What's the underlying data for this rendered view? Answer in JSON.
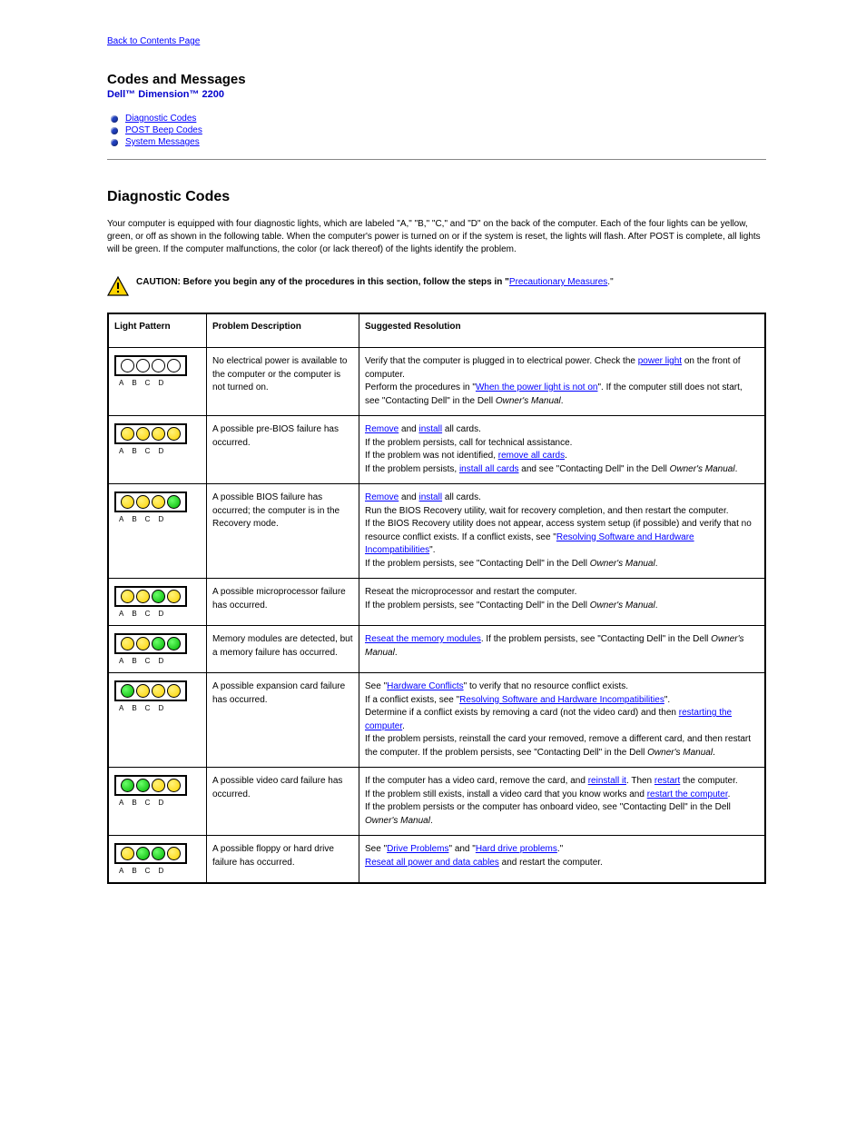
{
  "back": "Back to Contents Page",
  "page_title": "Codes and Messages",
  "subtitle": "Dell™ Dimension™ 2200",
  "toc": [
    {
      "label": "Diagnostic Codes"
    },
    {
      "label": "POST Beep Codes"
    },
    {
      "label": "System Messages"
    }
  ],
  "section_title": "Diagnostic Codes",
  "section_desc_1": "Your computer is equipped with four diagnostic lights, which are labeled \"A,\" \"B,\" \"C,\" and \"D\" on the back of the computer. Each of the four lights can be yellow, green, or off as shown in the following table. When the computer's power is turned on or if the system is reset, the lights will flash. After POST is complete, all lights will be green. If the computer malfunctions, the color (or lack thereof) of the lights identify the problem.",
  "caution_bold": "CAUTION: Before you begin any of the procedures in this section, follow the steps in \"",
  "caution_link": "Precautionary Measures",
  "caution_tail": ".\"",
  "table": {
    "headers": [
      "Light Pattern",
      "Problem Description",
      "Suggested Resolution"
    ],
    "label_row": "A   B   C   D",
    "rows": [
      {
        "lights": [
          "off",
          "off",
          "off",
          "off"
        ],
        "problem": "No electrical power is available to the computer or the computer is not turned on.",
        "resolution_segments": [
          {
            "t": "Verify that the computer is plugged in to electrical power. Check the ",
            "link": false
          },
          {
            "t": "power light",
            "link": true
          },
          {
            "t": " on the front of computer.",
            "link": false
          },
          {
            "t": "\nPerform the procedures in \"",
            "link": false
          },
          {
            "t": "When the power light is not on",
            "link": true
          },
          {
            "t": "\". If the computer still does not start, see \"Contacting Dell\" in the Dell ",
            "link": false
          },
          {
            "t": "Owner's Manual",
            "link": false,
            "italic": true
          },
          {
            "t": ".",
            "link": false
          }
        ]
      },
      {
        "lights": [
          "y",
          "y",
          "y",
          "y"
        ],
        "problem": "A possible pre-BIOS failure has occurred.",
        "resolution_segments": [
          {
            "t": "Remove",
            "link": true
          },
          {
            "t": " and ",
            "link": false
          },
          {
            "t": "install",
            "link": true
          },
          {
            "t": " all cards.",
            "link": false
          },
          {
            "t": "\nIf the problem persists, call for technical assistance.",
            "link": false
          },
          {
            "t": "\nIf the problem was not identified, ",
            "link": false
          },
          {
            "t": "remove all cards",
            "link": true
          },
          {
            "t": ".",
            "link": false
          },
          {
            "t": "\nIf the problem persists, ",
            "link": false
          },
          {
            "t": "install all cards",
            "link": true
          },
          {
            "t": " and see \"Contacting Dell\" in the Dell ",
            "link": false
          },
          {
            "t": "Owner's Manual",
            "link": false,
            "italic": true
          },
          {
            "t": ".",
            "link": false
          }
        ]
      },
      {
        "lights": [
          "y",
          "y",
          "y",
          "g"
        ],
        "problem": "A possible BIOS failure has occurred; the computer is in the Recovery mode.",
        "resolution_segments": [
          {
            "t": "Remove",
            "link": true
          },
          {
            "t": " and ",
            "link": false
          },
          {
            "t": "install",
            "link": true
          },
          {
            "t": " all cards.",
            "link": false
          },
          {
            "t": "\nRun the BIOS Recovery utility, wait for recovery completion, and then restart the computer.",
            "link": false
          },
          {
            "t": "\nIf the BIOS Recovery utility does not appear, access system setup (if possible) and verify that no resource conflict exists. If a conflict exists, see \"",
            "link": false
          },
          {
            "t": "Resolving Software and Hardware Incompatibilities",
            "link": true
          },
          {
            "t": "\".",
            "link": false
          },
          {
            "t": "\nIf the problem persists, see \"Contacting Dell\" in the Dell ",
            "link": false
          },
          {
            "t": "Owner's Manual",
            "link": false,
            "italic": true
          },
          {
            "t": ".",
            "link": false
          }
        ]
      },
      {
        "lights": [
          "y",
          "y",
          "g",
          "y"
        ],
        "problem": "A possible microprocessor failure has occurred.",
        "resolution_segments": [
          {
            "t": "Reseat the microprocessor and restart the computer.",
            "link": false
          },
          {
            "t": "\nIf the problem persists, see \"Contacting Dell\" in the Dell ",
            "link": false
          },
          {
            "t": "Owner's Manual",
            "link": false,
            "italic": true
          },
          {
            "t": ".",
            "link": false
          }
        ]
      },
      {
        "lights": [
          "y",
          "y",
          "g",
          "g"
        ],
        "problem": "Memory modules are detected, but a memory failure has occurred.",
        "resolution_segments": [
          {
            "t": "Reseat the memory modules",
            "link": true
          },
          {
            "t": ". If the problem persists, see \"Contacting Dell\" in the Dell ",
            "link": false
          },
          {
            "t": "Owner's Manual",
            "link": false,
            "italic": true
          },
          {
            "t": ".",
            "link": false
          }
        ]
      },
      {
        "lights": [
          "g",
          "y",
          "y",
          "y"
        ],
        "problem": "A possible expansion card failure has occurred.",
        "resolution_segments": [
          {
            "t": "See \"",
            "link": false
          },
          {
            "t": "Hardware Conflicts",
            "link": true
          },
          {
            "t": "\" to verify that no resource conflict exists.",
            "link": false
          },
          {
            "t": "\nIf a conflict exists, see \"",
            "link": false
          },
          {
            "t": "Resolving Software and Hardware Incompatibilities",
            "link": true
          },
          {
            "t": "\".",
            "link": false
          },
          {
            "t": "\nDetermine if a conflict exists by removing a card (not the video card) and then ",
            "link": false
          },
          {
            "t": "restarting the computer",
            "link": true
          },
          {
            "t": ".",
            "link": false
          },
          {
            "t": "\nIf the problem persists, reinstall the card your removed, remove a different card, and then restart the computer. If the problem persists, see \"Contacting Dell\" in the Dell ",
            "link": false
          },
          {
            "t": "Owner's Manual",
            "link": false,
            "italic": true
          },
          {
            "t": ".",
            "link": false
          }
        ]
      },
      {
        "lights": [
          "g",
          "g",
          "y",
          "y"
        ],
        "problem": "A possible video card failure has occurred.",
        "resolution_segments": [
          {
            "t": "If the computer has a video card, remove the card, and ",
            "link": false
          },
          {
            "t": "reinstall it",
            "link": true
          },
          {
            "t": ". Then ",
            "link": false
          },
          {
            "t": "restart",
            "link": true
          },
          {
            "t": " the computer.",
            "link": false
          },
          {
            "t": "\nIf the problem still exists, install a video card that you know works and ",
            "link": false
          },
          {
            "t": "restart the computer",
            "link": true
          },
          {
            "t": ".",
            "link": false
          },
          {
            "t": "\nIf the problem persists or the computer has onboard video, see \"Contacting Dell\" in the Dell ",
            "link": false
          },
          {
            "t": "Owner's Manual",
            "link": false,
            "italic": true
          },
          {
            "t": ".",
            "link": false
          }
        ]
      },
      {
        "lights": [
          "y",
          "g",
          "g",
          "y"
        ],
        "problem": "A possible floppy or hard drive failure has occurred.",
        "resolution_segments": [
          {
            "t": "See \"",
            "link": false
          },
          {
            "t": "Drive Problems",
            "link": true
          },
          {
            "t": "\" and \"",
            "link": false
          },
          {
            "t": "Hard drive problems",
            "link": true
          },
          {
            "t": ".\"",
            "link": false
          },
          {
            "t": "\n",
            "link": false
          },
          {
            "t": "Reseat all power and data cables",
            "link": true
          },
          {
            "t": " and restart the computer.",
            "link": false
          }
        ]
      }
    ]
  }
}
